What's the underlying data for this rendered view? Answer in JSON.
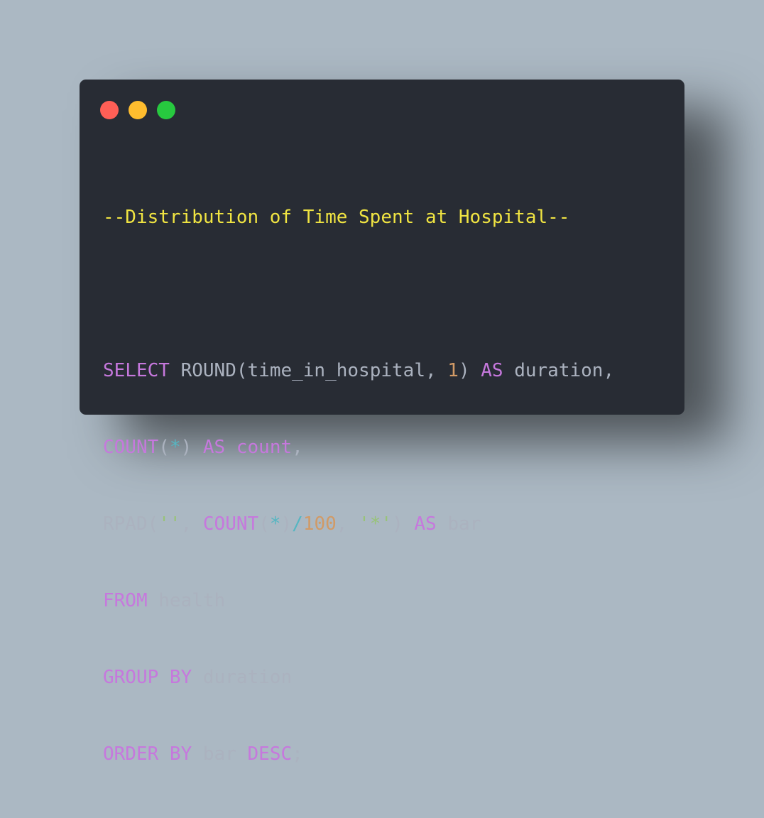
{
  "window": {
    "controls": {
      "close_color": "#ff5f56",
      "minimize_color": "#ffbd2e",
      "maximize_color": "#27c93f"
    }
  },
  "code": {
    "comment": "--Distribution of Time Spent at Hospital--",
    "line1": {
      "select": "SELECT",
      "round": "ROUND",
      "open": "(",
      "col": "time_in_hospital, ",
      "num": "1",
      "close": ") ",
      "as": "AS",
      "alias": " duration,"
    },
    "line2": {
      "count": "COUNT",
      "open": "(",
      "star": "*",
      "close": ") ",
      "as": "AS",
      "alias": " count",
      "comma": ","
    },
    "line3": {
      "rpad": "RPAD",
      "open": "(",
      "empty_str": "''",
      "sep": ", ",
      "count": "COUNT",
      "open2": "(",
      "star": "*",
      "close2": ")",
      "div": "/",
      "num": "100",
      "sep2": ", ",
      "star_str": "'*'",
      "close": ") ",
      "as": "AS",
      "alias": " bar"
    },
    "line4": {
      "from": "FROM",
      "table": " health"
    },
    "line5": {
      "group_by": "GROUP BY",
      "col": " duration"
    },
    "line6": {
      "order_by": "ORDER BY",
      "col": " bar ",
      "desc": "DESC",
      "end": ";"
    }
  },
  "colors": {
    "background": "#abb8c3",
    "editor_bg": "#282c34",
    "comment": "#f0e442",
    "keyword": "#c678dd",
    "plain": "#abb2bf",
    "number": "#d19a66",
    "operator": "#56b6c2",
    "string": "#98c379"
  }
}
